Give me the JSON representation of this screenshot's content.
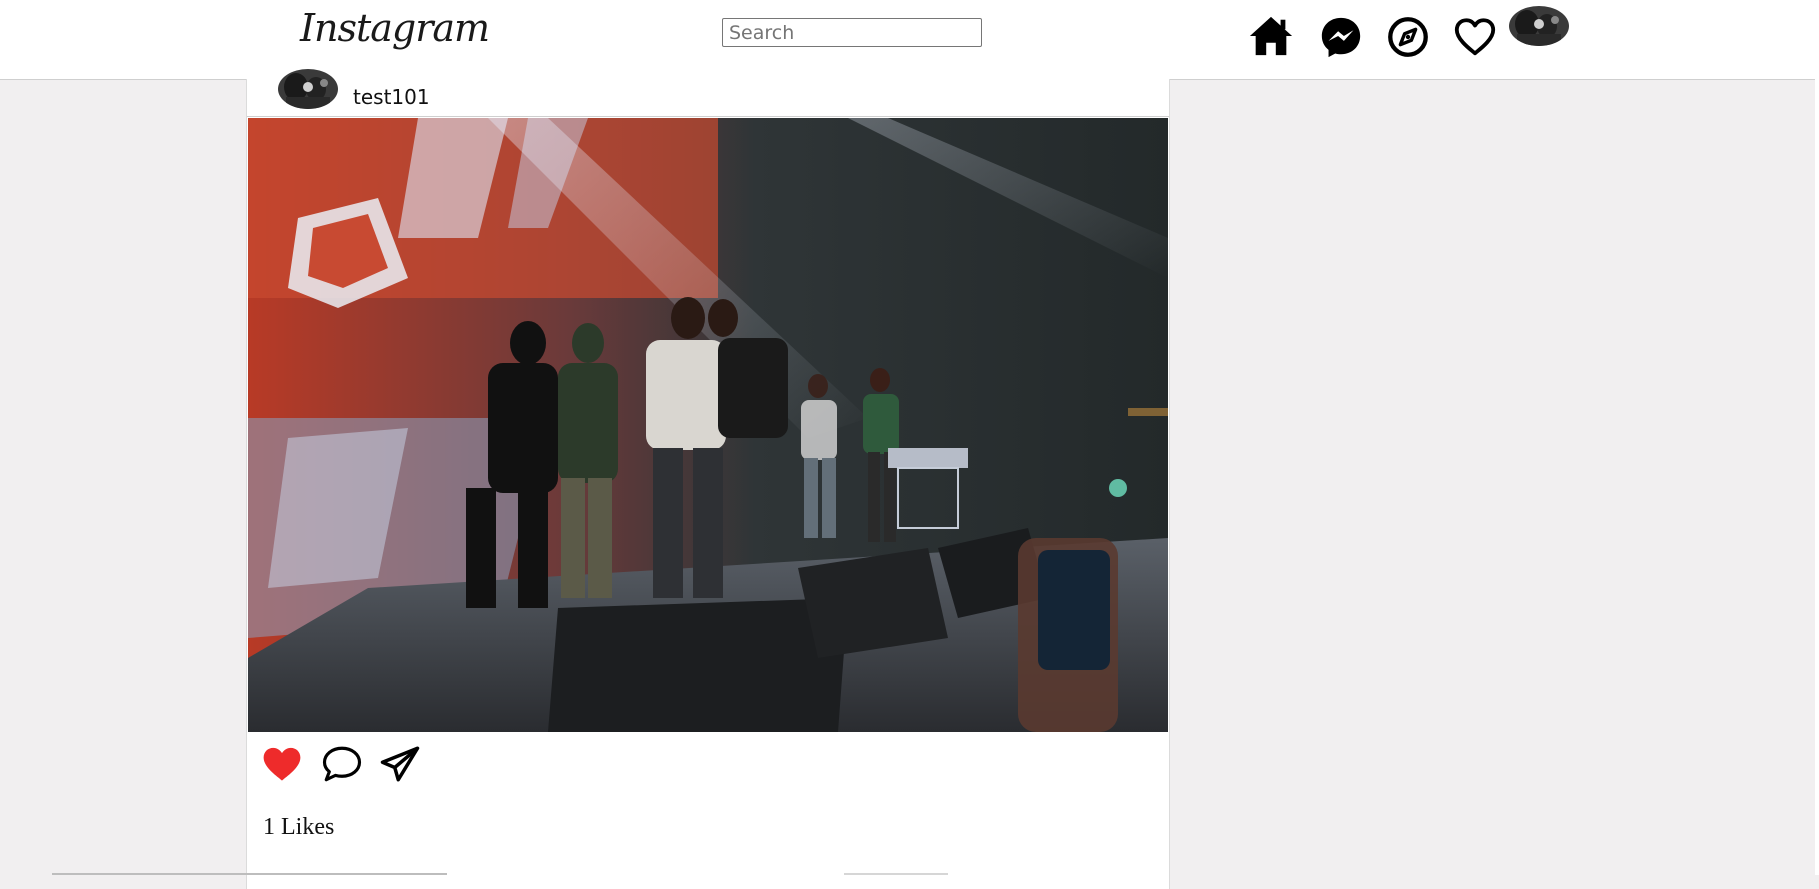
{
  "app": {
    "logo_text": "Instagram"
  },
  "header": {
    "search": {
      "placeholder": "Search",
      "value": ""
    },
    "nav_icons": [
      "home-icon",
      "messenger-icon",
      "explore-icon",
      "heart-icon",
      "profile-avatar"
    ]
  },
  "post": {
    "username": "test101",
    "image_description_icon": "concert-photo",
    "actions": [
      "like-heart-filled-icon",
      "comment-icon",
      "share-icon"
    ],
    "liked": true,
    "likes_text": "1 Likes"
  },
  "colors": {
    "like_red": "#ee2b2b",
    "icon_black": "#000000",
    "page_bg": "#f1eff0"
  }
}
